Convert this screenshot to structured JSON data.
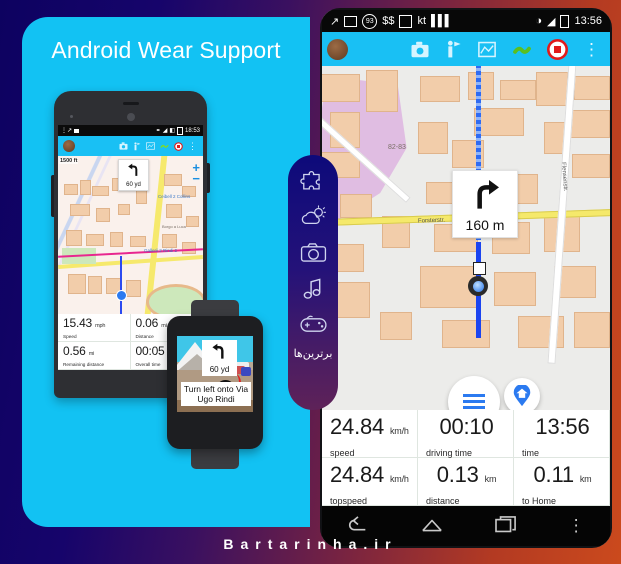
{
  "frame": {
    "gradient_from": "#0d0260",
    "gradient_to": "#cb4a1d"
  },
  "watermark": {
    "text": "Bartarinha.ir"
  },
  "left_panel": {
    "background": "#12c2f3",
    "title": "Android Wear Support",
    "phone": {
      "status_bar": {
        "time": "18:53",
        "icons": [
          "usb-debug-icon",
          "notification-icon",
          "bluetooth-icon",
          "wifi-icon",
          "signal-icon",
          "battery-icon"
        ]
      },
      "toolbar": {
        "avatar": "profile-avatar",
        "icons": [
          "camera-icon",
          "flag-person-icon",
          "map-icon",
          "activity-icon",
          "record-stop-icon",
          "overflow-menu-icon"
        ]
      },
      "map": {
        "scale_label": "1500 ft",
        "zoom_in": "+",
        "zoom_out": "−",
        "turn_card": {
          "direction": "turn-left",
          "distance": "60 yd"
        },
        "labels": [
          "Ceibell 2 Collins",
          "Gallerii 2 Rindi 2",
          "Borgo a Luca"
        ]
      },
      "stats": [
        {
          "value": "15.43",
          "unit": "mph",
          "label": "Speed"
        },
        {
          "value": "0.06",
          "unit": "mi",
          "label": "Distance"
        },
        {
          "value": "0.56",
          "unit": "mi",
          "label": "Remaining distance"
        },
        {
          "value": "00:05",
          "unit": "",
          "label": "Overall time"
        }
      ],
      "nav_bar": {
        "back": "back-icon",
        "home": "home-icon"
      }
    },
    "watch": {
      "turn_card": {
        "direction": "turn-left",
        "distance": "60 yd"
      },
      "instruction": "Turn left onto Via Ugo Rindi"
    }
  },
  "feature_strip": {
    "background_from": "#0d0a7a",
    "background_to": "#5e2258",
    "icons": [
      "puzzle-icon",
      "weather-icon",
      "camera-icon",
      "music-icon",
      "gamepad-icon"
    ],
    "brand_fa": "برترین‌ها"
  },
  "right_panel": {
    "status_bar": {
      "time": "13:56",
      "left_icons": [
        "usb-debug-icon",
        "screenshot-icon"
      ],
      "badge_93": "93",
      "money": "$$",
      "calendar": "calendar-icon",
      "kt": "kt",
      "bars": "bars-icon",
      "right_icons": [
        "wifi-icon",
        "signal-icon",
        "battery-icon"
      ]
    },
    "toolbar": {
      "avatar": "profile-avatar",
      "icons": [
        "camera-icon",
        "flag-person-icon",
        "map-icon",
        "activity-icon",
        "record-stop-icon",
        "overflow-menu-icon"
      ]
    },
    "map": {
      "turn_card": {
        "direction": "turn-right",
        "distance": "160 m"
      },
      "labels": [
        "82-83",
        "Forsterstr.",
        "Flensenstr.",
        "Flensenstr."
      ],
      "fab_menu": "hamburger-menu-icon",
      "fab_home": "home-pin-icon"
    },
    "stats": [
      {
        "value": "24.84",
        "unit": "km/h",
        "label": "speed"
      },
      {
        "value": "00:10",
        "unit": "",
        "label": "driving time"
      },
      {
        "value": "13:56",
        "unit": "",
        "label": "time"
      },
      {
        "value": "24.84",
        "unit": "km/h",
        "label": "topspeed"
      },
      {
        "value": "0.13",
        "unit": "km",
        "label": "distance"
      },
      {
        "value": "0.11",
        "unit": "km",
        "label": "to Home"
      }
    ],
    "nav_bar": {
      "back": "back-icon",
      "home": "home-icon",
      "recents": "recents-icon",
      "overflow": "overflow-menu-icon"
    }
  }
}
